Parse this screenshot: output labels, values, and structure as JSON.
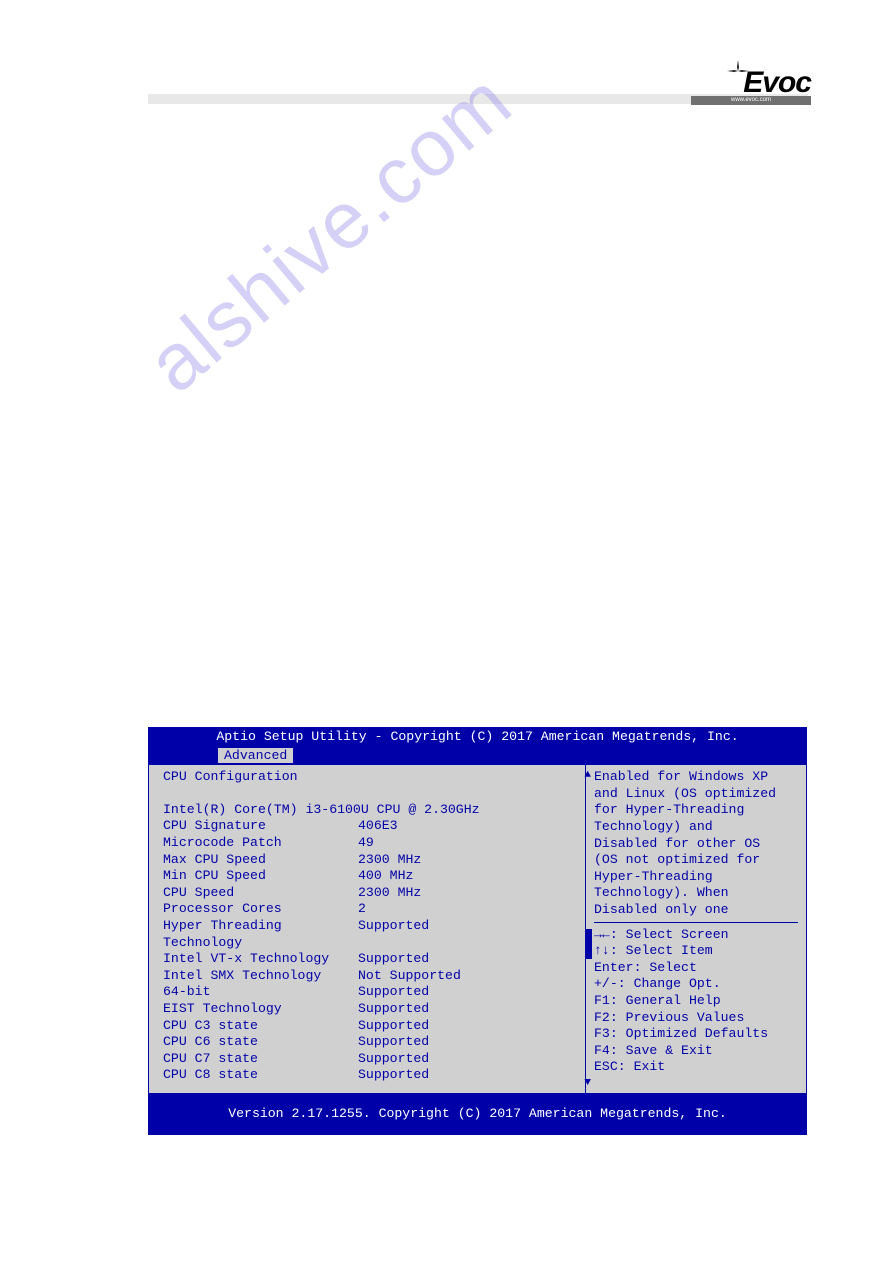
{
  "header": {
    "logo_text": "Evoc",
    "url_text": "www.evoc.com"
  },
  "watermark": "alshive.com",
  "bios": {
    "title": "Aptio Setup Utility - Copyright (C) 2017 American Megatrends, Inc.",
    "tab_active": "Advanced",
    "section_title": "CPU Configuration",
    "cpu_model": "Intel(R) Core(TM) i3-6100U CPU @ 2.30GHz",
    "rows": [
      {
        "label": "CPU Signature",
        "value": "406E3"
      },
      {
        "label": "Microcode Patch",
        "value": "49"
      },
      {
        "label": "Max CPU Speed",
        "value": "2300 MHz"
      },
      {
        "label": "Min CPU Speed",
        "value": "400 MHz"
      },
      {
        "label": "CPU Speed",
        "value": "2300 MHz"
      },
      {
        "label": "Processor Cores",
        "value": "2"
      },
      {
        "label": "Hyper Threading",
        "value": "Supported"
      },
      {
        "label": "Technology",
        "value": ""
      },
      {
        "label": "Intel VT-x Technology",
        "value": "Supported"
      },
      {
        "label": "Intel SMX Technology",
        "value": "Not Supported"
      },
      {
        "label": "64-bit",
        "value": "Supported"
      },
      {
        "label": "EIST Technology",
        "value": "Supported"
      },
      {
        "label": "CPU C3 state",
        "value": "Supported"
      },
      {
        "label": "CPU C6 state",
        "value": "Supported"
      },
      {
        "label": "CPU C7 state",
        "value": "Supported"
      },
      {
        "label": "CPU C8 state",
        "value": "Supported"
      }
    ],
    "help": [
      "Enabled for Windows XP",
      "and Linux (OS optimized",
      "for Hyper-Threading",
      "Technology) and",
      "Disabled for other OS",
      "(OS not optimized for",
      "Hyper-Threading",
      "Technology). When",
      "Disabled only one"
    ],
    "keys": [
      "→←: Select Screen",
      "↑↓: Select Item",
      "Enter: Select",
      "+/-: Change Opt.",
      "F1: General Help",
      "F2: Previous Values",
      "F3: Optimized Defaults",
      "F4: Save & Exit",
      "ESC: Exit"
    ],
    "footer": "Version 2.17.1255. Copyright (C) 2017 American Megatrends, Inc."
  }
}
